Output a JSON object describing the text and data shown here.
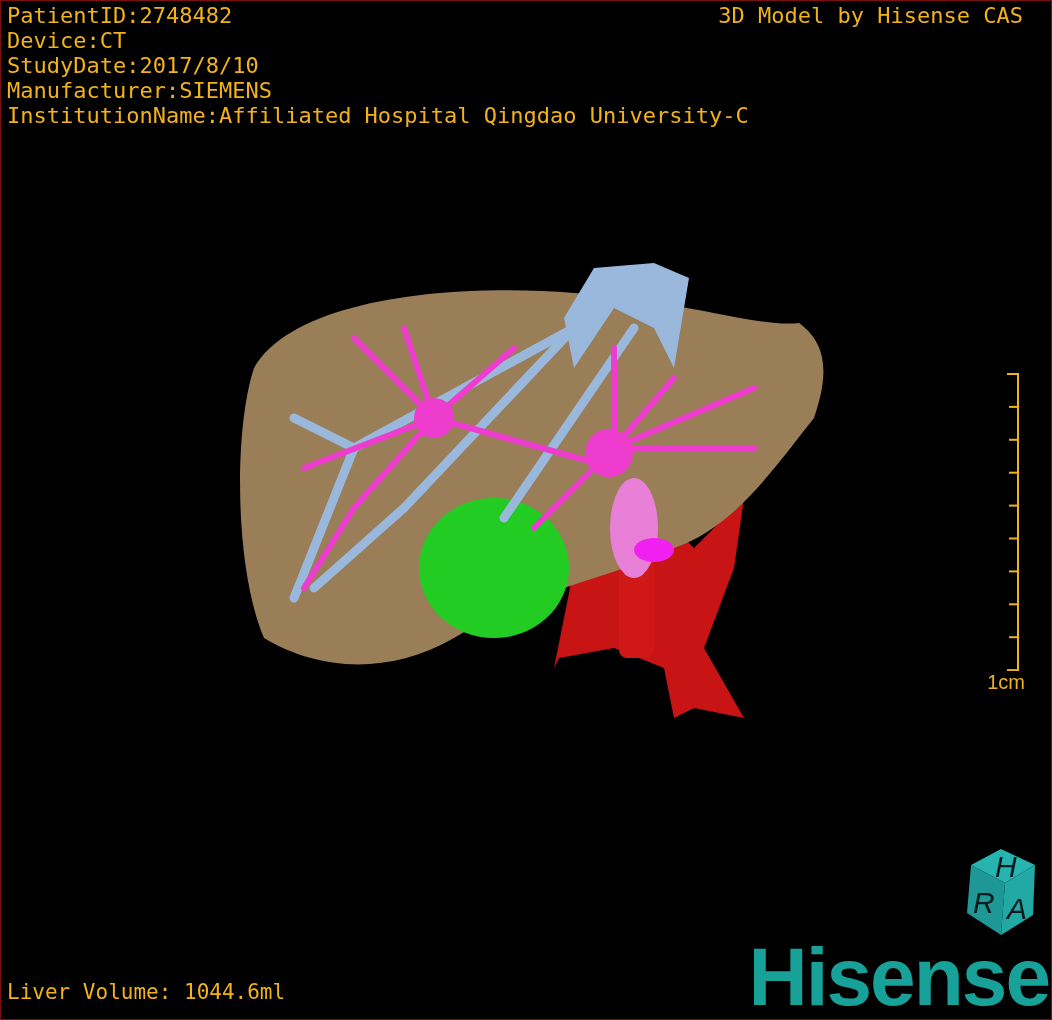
{
  "info_lines": [
    "PatientID:2748482",
    "Device:CT",
    "StudyDate:2017/8/10",
    "Manufacturer:SIEMENS",
    "InstitutionName:Affiliated Hospital Qingdao University-C"
  ],
  "title": "3D Model by Hisense CAS",
  "scale_bar": {
    "label": "1cm"
  },
  "volume": "Liver Volume: 1044.6ml",
  "cube": {
    "top": "H",
    "left": "R",
    "front": "A"
  },
  "logo": "Hisense"
}
